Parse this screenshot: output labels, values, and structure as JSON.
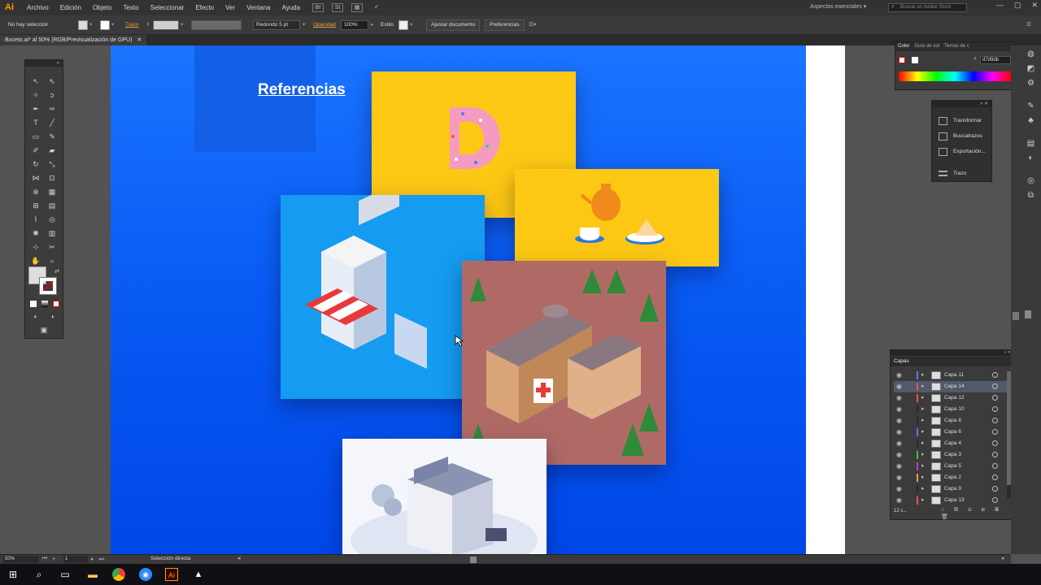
{
  "app": {
    "logo": "Ai"
  },
  "menu": [
    "Archivo",
    "Edición",
    "Objeto",
    "Texto",
    "Seleccionar",
    "Efecto",
    "Ver",
    "Ventana",
    "Ayuda"
  ],
  "menubar_icons": [
    "bridge-icon",
    "stock-icon",
    "arrange-icon",
    "send-icon"
  ],
  "workspace": "Aspectos esenciales",
  "search_placeholder": "Buscar en Adobe Stock",
  "control_bar": {
    "selection": "No hay selección",
    "stroke_label": "Trazo",
    "brush": "Redondo 5 pt",
    "opacity_label": "Opacidad",
    "opacity_value": "100%",
    "style_label": "Estilo",
    "doc_button": "Ajustar documento",
    "prefs_button": "Preferencias"
  },
  "doc_tab": "Boceto.ai* al 50% (RGB/Previsualización de GPU)",
  "artboard": {
    "title": "Referencias",
    "bg": "#0a5cf5"
  },
  "color_panel": {
    "tabs": [
      "Color",
      "Guía de col",
      "Temas de c"
    ],
    "hex": "d7d9db"
  },
  "props_panel": {
    "items": [
      "Transformar",
      "Buscatrazos",
      "Exportación...",
      "Trazo"
    ]
  },
  "layers_panel": {
    "title": "Capas",
    "layers": [
      {
        "name": "Capa 11",
        "color": "#4f7cff"
      },
      {
        "name": "Capa 14",
        "color": "#ff4f4f",
        "selected": true
      },
      {
        "name": "Capa 12",
        "color": "#ff4f4f"
      },
      {
        "name": "Capa 10",
        "color": "#2a2a2a"
      },
      {
        "name": "Capa 8",
        "color": "#2a2a2a"
      },
      {
        "name": "Capa 6",
        "color": "#4f7cff"
      },
      {
        "name": "Capa 4",
        "color": "#2a2a2a"
      },
      {
        "name": "Capa 3",
        "color": "#3fbf3f"
      },
      {
        "name": "Capa 5",
        "color": "#bf3fbf"
      },
      {
        "name": "Capa 2",
        "color": "#ff9a3f"
      },
      {
        "name": "Capa 9",
        "color": "#2a2a2a"
      },
      {
        "name": "Capa 13",
        "color": "#ff4f4f"
      }
    ],
    "footer": "12 c..."
  },
  "status": {
    "zoom": "50%",
    "page": "1",
    "tool": "Selección directa"
  },
  "taskbar_icons": [
    "windows-start-icon",
    "search-icon",
    "task-view-icon",
    "file-explorer-icon",
    "chrome-icon",
    "app-icon",
    "illustrator-icon",
    "photos-icon"
  ]
}
